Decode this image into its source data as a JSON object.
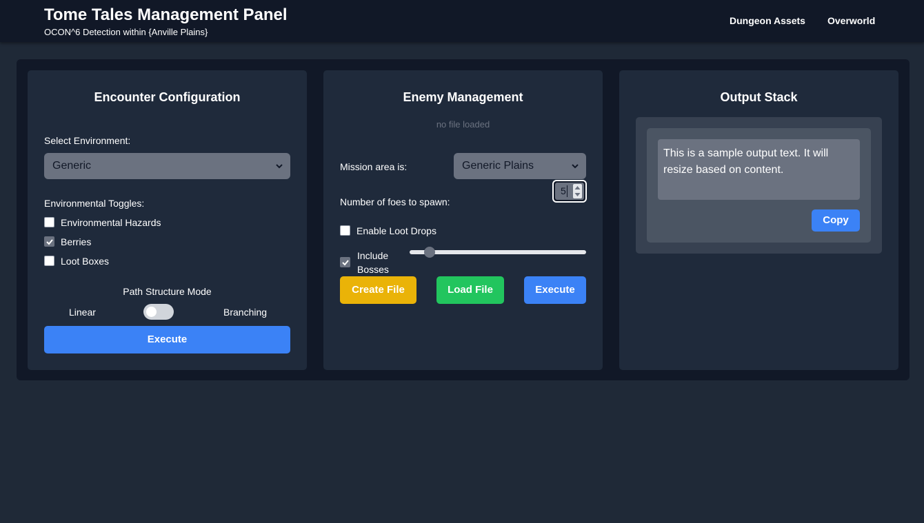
{
  "header": {
    "title": "Tome Tales Management Panel",
    "subtitle": "OCON^6 Detection within {Anville Plains}",
    "nav": [
      "Dungeon Assets",
      "Overworld"
    ]
  },
  "encounter": {
    "title": "Encounter Configuration",
    "env_label": "Select Environment:",
    "env_value": "Generic",
    "toggles_label": "Environmental Toggles:",
    "toggles": [
      {
        "label": "Environmental Hazards",
        "checked": false
      },
      {
        "label": "Berries",
        "checked": true
      },
      {
        "label": "Loot Boxes",
        "checked": false
      }
    ],
    "path_mode_label": "Path Structure Mode",
    "path_left": "Linear",
    "path_right": "Branching",
    "execute": "Execute"
  },
  "enemy": {
    "title": "Enemy Management",
    "file_status": "no file loaded",
    "area_label": "Mission area is:",
    "area_value": "Generic Plains",
    "foes_label": "Number of foes to spawn:",
    "foes_value": "5",
    "loot_label": "Enable Loot Drops",
    "loot_checked": false,
    "bosses_label_1": "Include",
    "bosses_label_2": "Bosses",
    "bosses_checked": true,
    "create": "Create File",
    "load": "Load File",
    "execute": "Execute"
  },
  "output": {
    "title": "Output Stack",
    "text": "This is a sample output text. It will resize based on content.",
    "copy": "Copy"
  },
  "colors": {
    "accent_blue": "#3b82f6",
    "accent_yellow": "#eab308",
    "accent_green": "#22c55e"
  }
}
